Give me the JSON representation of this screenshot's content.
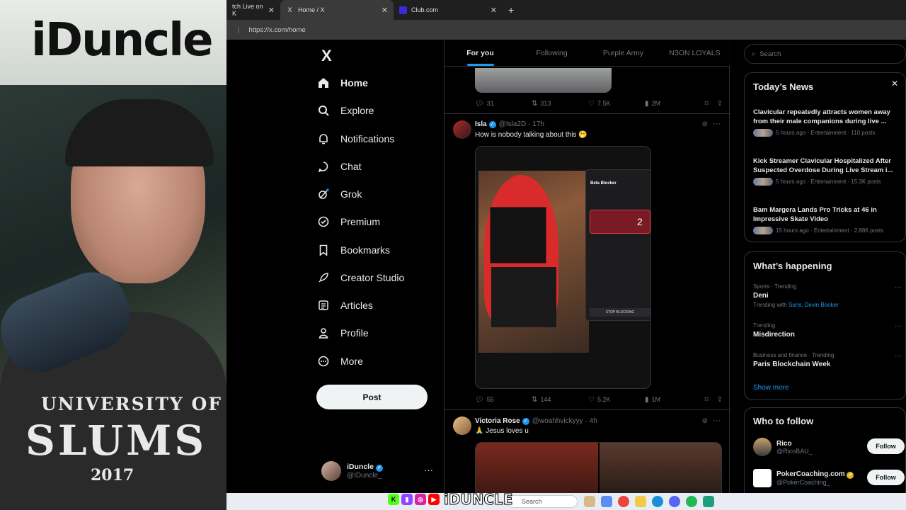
{
  "webcam": {
    "banner_text": "iDuncle",
    "shirt_line1": "UNIVERSITY OF",
    "shirt_line2": "SLUMS",
    "shirt_line3": "2017"
  },
  "browser": {
    "tabs": [
      {
        "label": "tch Live on K",
        "favicon": "",
        "active": false
      },
      {
        "label": "Home / X",
        "favicon": "X",
        "active": true
      },
      {
        "label": "Club.com",
        "favicon": "",
        "active": false
      }
    ],
    "new_tab": "+",
    "url": "https://x.com/home"
  },
  "nav": {
    "logo": "X",
    "items": [
      {
        "label": "Home",
        "icon": "home-icon"
      },
      {
        "label": "Explore",
        "icon": "search-icon"
      },
      {
        "label": "Notifications",
        "icon": "bell-icon"
      },
      {
        "label": "Chat",
        "icon": "chat-icon"
      },
      {
        "label": "Grok",
        "icon": "grok-icon"
      },
      {
        "label": "Premium",
        "icon": "premium-icon"
      },
      {
        "label": "Bookmarks",
        "icon": "bookmark-icon"
      },
      {
        "label": "Creator Studio",
        "icon": "rocket-icon"
      },
      {
        "label": "Articles",
        "icon": "article-icon"
      },
      {
        "label": "Profile",
        "icon": "person-icon"
      },
      {
        "label": "More",
        "icon": "more-circle-icon"
      }
    ],
    "post_label": "Post",
    "account": {
      "name": "iDuncle",
      "handle": "@IDuncle_",
      "more": "···"
    }
  },
  "feed": {
    "tabs": [
      "For you",
      "Following",
      "Purple Army",
      "N3ON LOYALS"
    ],
    "first_post_actions": {
      "replies": "31",
      "reposts": "313",
      "likes": "7.5K",
      "views": "2M"
    },
    "tweets": [
      {
        "name": "Isla",
        "handle": "@Isla2D",
        "time": "· 17h",
        "text": "How is nobody talking about this 🫢",
        "media_overlay": {
          "title": "Beta Blocker",
          "count": "2",
          "stop": "STOP BLOCKING"
        },
        "actions": {
          "replies": "55",
          "reposts": "144",
          "likes": "5.2K",
          "views": "1M"
        }
      },
      {
        "name": "Victoria Rose",
        "handle": "@woahhvickyyy",
        "time": "· 4h",
        "text": "🙏 Jesus loves u"
      }
    ]
  },
  "right": {
    "search_placeholder": "Search",
    "todays_news": {
      "title": "Today’s News",
      "items": [
        {
          "headline": "Clavicular repeatedly attracts women away from their male companions during live ...",
          "meta": "5 hours ago · Entertainment · 110 posts"
        },
        {
          "headline": "Kick Streamer Clavicular Hospitalized After Suspected Overdose During Live Stream i...",
          "meta": "5 hours ago · Entertainment · 15.3K posts"
        },
        {
          "headline": "Bam Margera Lands Pro Tricks at 46 in Impressive Skate Video",
          "meta": "15 hours ago · Entertainment · 2,886 posts"
        }
      ]
    },
    "whats_happening": {
      "title": "What’s happening",
      "trends": [
        {
          "category": "Sports · Trending",
          "name": "Deni",
          "with_prefix": "Trending with",
          "with_links": "Suns, Devin Booker"
        },
        {
          "category": "Trending",
          "name": "Misdirection"
        },
        {
          "category": "Business and finance · Trending",
          "name": "Paris Blockchain Week"
        }
      ],
      "show_more": "Show more"
    },
    "who_to_follow": {
      "title": "Who to follow",
      "accounts": [
        {
          "name": "Rico",
          "handle": "@RicoBAU_",
          "button": "Follow"
        },
        {
          "name": "PokerCoaching.com",
          "handle": "@PokerCoaching_",
          "button": "Follow"
        }
      ]
    }
  },
  "taskbar": {
    "search_placeholder": "Search"
  },
  "overlay_brand": "iDUNCLE"
}
